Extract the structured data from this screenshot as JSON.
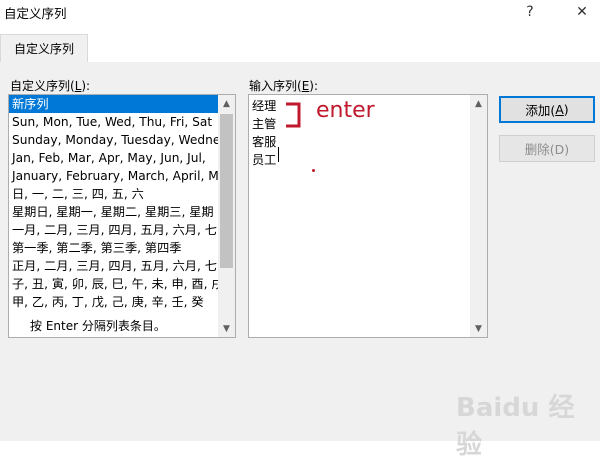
{
  "window": {
    "title": "自定义序列",
    "help_glyph": "?",
    "close_glyph": "✕"
  },
  "tabs": [
    {
      "label": "自定义序列"
    }
  ],
  "left_list": {
    "label": "自定义序列(",
    "label_hotkey": "L",
    "label_suffix": "):",
    "items": [
      "新序列",
      "Sun, Mon, Tue, Wed, Thu, Fri, Sat",
      "Sunday, Monday, Tuesday, Wednesday",
      "Jan, Feb, Mar, Apr, May, Jun, Jul,",
      "January, February, March, April, Ma",
      "日, 一, 二, 三, 四, 五, 六",
      "星期日, 星期一, 星期二, 星期三, 星期",
      "一月, 二月, 三月, 四月, 五月, 六月, 七",
      "第一季, 第二季, 第三季, 第四季",
      "正月, 二月, 三月, 四月, 五月, 六月, 七",
      "子, 丑, 寅, 卯, 辰, 巳, 午, 未, 申, 酉, 戌",
      "甲, 乙, 丙, 丁, 戊, 己, 庚, 辛, 壬, 癸"
    ],
    "selected_index": 0
  },
  "right_input": {
    "label": "输入序列(",
    "label_hotkey": "E",
    "label_suffix": "):",
    "lines": [
      "经理",
      "主管",
      "客服",
      "员工"
    ]
  },
  "buttons": {
    "add": {
      "label": "添加(",
      "hotkey": "A",
      "suffix": ")"
    },
    "delete": {
      "label": "删除(D)"
    }
  },
  "hint": "按 Enter 分隔列表条目。",
  "annotation": {
    "text": "enter",
    "color": "#c0182c"
  },
  "watermark": "Baidu 经验",
  "colors": {
    "selection": "#0078d7",
    "panel": "#f0f0f0",
    "default_button_border": "#0078d7"
  }
}
